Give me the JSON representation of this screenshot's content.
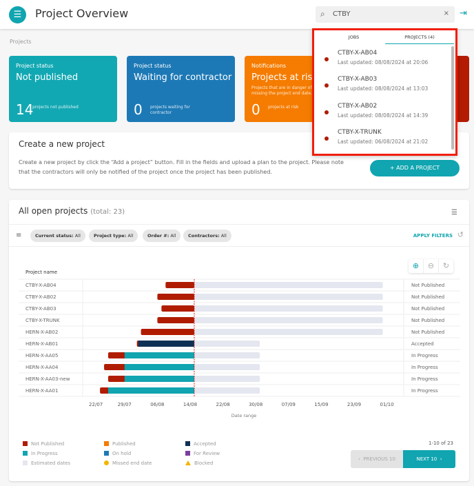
{
  "header": {
    "title": "Project Overview",
    "search_value": "CTBY",
    "menu_icon": "hamburger-icon",
    "search_icon": "search-icon",
    "clear_icon": "close-icon",
    "logout_icon": "logout-icon"
  },
  "breadcrumb": "Projects",
  "cards": [
    {
      "label": "Project status",
      "title": "Not published",
      "number": "14",
      "number_desc": "projects not published",
      "color": "#12a8b3"
    },
    {
      "label": "Project status",
      "title": "Waiting for contractor",
      "number": "0",
      "number_desc": "projects waiting for contractor",
      "color": "#1d79b6"
    },
    {
      "label": "Notifications",
      "title": "Projects at risk",
      "desc": "Projects that are in danger of missing the project end date.",
      "number": "0",
      "number_desc": "projects at risk",
      "color": "#f57c00"
    }
  ],
  "create": {
    "title": "Create a new project",
    "text": "Create a new project by click the “Add a project” button. Fill in the fields and upload a plan to the project. Please note that the contractors will only be notified of the project once the project has been published.",
    "button": "ADD A PROJECT"
  },
  "projects": {
    "title": "All open projects",
    "total": "(total: 23)",
    "filters": [
      {
        "k": "Current status:",
        "v": " All"
      },
      {
        "k": "Project type:",
        "v": " All"
      },
      {
        "k": "Order #:",
        "v": " All"
      },
      {
        "k": "Contractors:",
        "v": " All"
      }
    ],
    "apply": "APPLY FILTERS",
    "pagination": "1-10 of 23",
    "prev": "PREVIOUS 10",
    "next": "NEXT 10"
  },
  "legend": [
    {
      "label": "Not Published",
      "color": "#b01c02"
    },
    {
      "label": "Published",
      "color": "#f57c00"
    },
    {
      "label": "Accepted",
      "color": "#0f3055"
    },
    {
      "label": "In Progress",
      "color": "#10a5b0"
    },
    {
      "label": "On hold",
      "color": "#1d79b6"
    },
    {
      "label": "For Review",
      "color": "#7b3fa0"
    },
    {
      "label": "Estimated dates",
      "color": "#e4e7ef"
    },
    {
      "label": "Missed end date",
      "color": "#f5b400"
    },
    {
      "label": "Blocked",
      "color": "#f5b400"
    }
  ],
  "search_results": {
    "tabs": [
      "JOBS",
      "PROJECTS (4)"
    ],
    "items": [
      {
        "name": "CTBY-X-AB04",
        "updated": "Last updated: 08/08/2024 at 20:06"
      },
      {
        "name": "CTBY-X-AB03",
        "updated": "Last updated: 08/08/2024 at 13:03"
      },
      {
        "name": "CTBY-X-AB02",
        "updated": "Last updated: 08/08/2024 at 14:39"
      },
      {
        "name": "CTBY-X-TRUNK",
        "updated": "Last updated: 06/08/2024 at 21:02"
      }
    ]
  },
  "chart_data": {
    "type": "gantt",
    "column_header": "Project name",
    "xlabel": "Date range",
    "today": "2024-08-15",
    "x_ticks": [
      "22/07",
      "29/07",
      "06/08",
      "14/08",
      "22/08",
      "30/08",
      "07/09",
      "15/09",
      "23/09",
      "01/10"
    ],
    "rows": [
      {
        "name": "CTBY-X-AB04",
        "status": "Not Published",
        "start": "2024-08-08",
        "phase2": null,
        "end": "2024-09-30"
      },
      {
        "name": "CTBY-X-AB02",
        "status": "Not Published",
        "start": "2024-08-06",
        "phase2": null,
        "end": "2024-09-30"
      },
      {
        "name": "CTBY-X-AB03",
        "status": "Not Published",
        "start": "2024-08-07",
        "phase2": null,
        "end": "2024-09-30"
      },
      {
        "name": "CTBY-X-TRUNK",
        "status": "Not Published",
        "start": "2024-08-06",
        "phase2": null,
        "end": "2024-09-30"
      },
      {
        "name": "HERN-X-AB02",
        "status": "Not Published",
        "start": "2024-08-02",
        "phase2": null,
        "end": "2024-09-30"
      },
      {
        "name": "HERN-X-AB01",
        "status": "Accepted",
        "start": "2024-08-01",
        "phase2": "2024-08-01",
        "end": "2024-08-31"
      },
      {
        "name": "HERN-X-AA05",
        "status": "In Progress",
        "start": "2024-07-25",
        "phase2": "2024-07-29",
        "end": "2024-08-31"
      },
      {
        "name": "HERN-X-AA04",
        "status": "In Progress",
        "start": "2024-07-24",
        "phase2": "2024-07-29",
        "end": "2024-08-31"
      },
      {
        "name": "HERN-X-AA03-new",
        "status": "In Progress",
        "start": "2024-07-25",
        "phase2": "2024-07-29",
        "end": "2024-08-31"
      },
      {
        "name": "HERN-X-AA01",
        "status": "In Progress",
        "start": "2024-07-23",
        "phase2": "2024-07-25",
        "end": "2024-08-31"
      }
    ]
  }
}
